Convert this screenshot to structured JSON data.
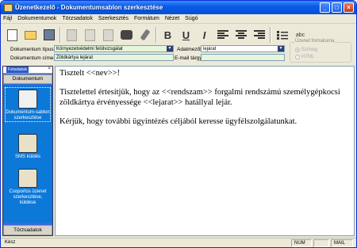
{
  "window": {
    "title": "Üzenetkezelő - Dokumentumsablon szerkesztése",
    "min": "_",
    "max": "□",
    "close": "×"
  },
  "menu": [
    "Fájl",
    "Dokumentumok",
    "Törzsadatok",
    "Szerkesztés",
    "Formátum",
    "Nézet",
    "Súgó"
  ],
  "toolbar": {
    "bold": "B",
    "underline": "U",
    "italic": "I",
    "abc": "abc"
  },
  "fields": {
    "type_label": "Dokumentum típus",
    "type_value": "Környezetvédelmi felülvizsgálat",
    "name_label": "Dokumentum címe:",
    "name_value": "Zöldkártya lejárat",
    "datafield_label": "Adatmezők",
    "datafield_value": "lejárat",
    "email_label": "E-mail tárgya",
    "email_value": ""
  },
  "format": {
    "title": "Üzenet formátuma",
    "option1": "Szöveg",
    "option2": "HTML",
    "selected": "Szöveg"
  },
  "sidebar": {
    "header": "Feladatok",
    "close": "×",
    "category": "Dokumentum",
    "items": [
      {
        "label": "Dokumentum-sablon szerkesztése"
      },
      {
        "label": "SMS küldés"
      },
      {
        "label": "Csoportos üzenet szerkesztése, küldése"
      }
    ],
    "footer": "Törzsadatok",
    "scroll": "▼"
  },
  "editor": {
    "p1": "Tisztelt <<nev>>!",
    "p2": "Tisztelettel értesítjük, hogy az <<rendszam>> forgalmi rendszámú személygépkocsi zöldkártya érvényessége <<lejarat>> hatállyal lejár.",
    "p3": "Kérjük, hogy további ügyintézés céljából keresse ügyfélszolgálatunkat."
  },
  "status": {
    "ready": "Kész",
    "num": "NUM",
    "mail": "MAIL"
  }
}
